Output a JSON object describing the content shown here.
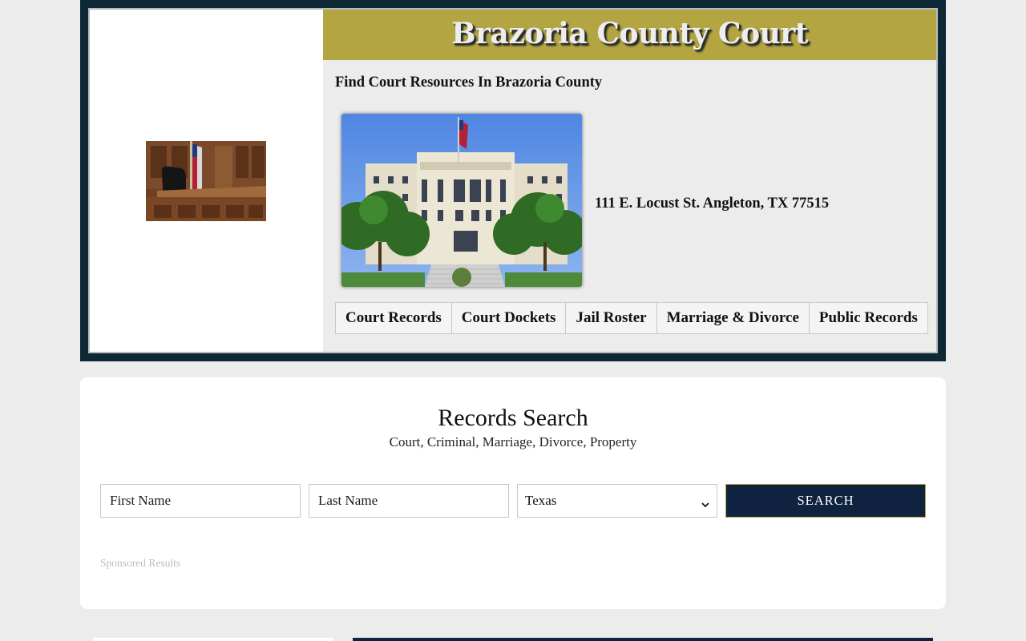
{
  "header": {
    "title": "Brazoria County Court",
    "tagline": "Find Court Resources In Brazoria County",
    "address": "111 E. Locust St. Angleton, TX 77515"
  },
  "nav": {
    "items": [
      "Court Records",
      "Court Dockets",
      "Jail Roster",
      "Marriage & Divorce",
      "Public Records"
    ]
  },
  "search": {
    "title": "Records Search",
    "subtitle": "Court, Criminal, Marriage, Divorce, Property",
    "first_name_placeholder": "First Name",
    "last_name_placeholder": "Last Name",
    "state_selected": "Texas",
    "button_label": "SEARCH",
    "sponsored": "Sponsored Results"
  },
  "colors": {
    "frame": "#0f2836",
    "title_band": "#b3a542",
    "button": "#0f2240",
    "page_bg": "#ececec"
  },
  "icons": {
    "select_arrow": "chevron-down-icon"
  }
}
